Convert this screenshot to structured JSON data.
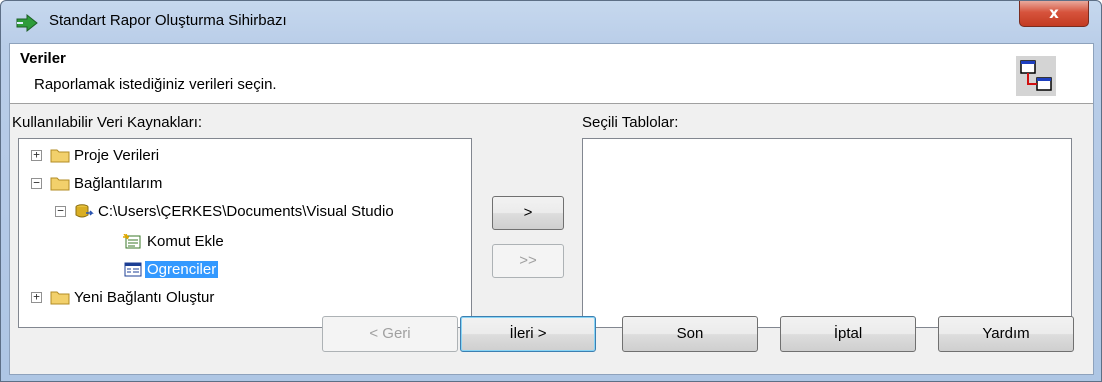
{
  "window": {
    "title": "Standart Rapor Oluşturma Sihirbazı",
    "close_label": "x"
  },
  "header": {
    "title": "Veriler",
    "subtitle": "Raporlamak istediğiniz verileri seçin."
  },
  "left_panel": {
    "label": "Kullanılabilir Veri Kaynakları:"
  },
  "right_panel": {
    "label": "Seçili Tablolar:"
  },
  "tree": {
    "items": [
      {
        "label": "Proje Verileri",
        "expander": "+"
      },
      {
        "label": "Bağlantılarım",
        "expander": "−"
      },
      {
        "label": "C:\\Users\\ÇERKES\\Documents\\Visual Studio",
        "expander": "−"
      },
      {
        "label": "Komut Ekle"
      },
      {
        "label": "Ogrenciler",
        "selected": true
      },
      {
        "label": "Yeni Bağlantı Oluştur",
        "expander": "+"
      }
    ]
  },
  "transfer": {
    "add_one": ">",
    "add_all": ">>"
  },
  "buttons": {
    "back": "< Geri",
    "next": "İleri >",
    "finish": "Son",
    "cancel": "İptal",
    "help": "Yardım"
  }
}
